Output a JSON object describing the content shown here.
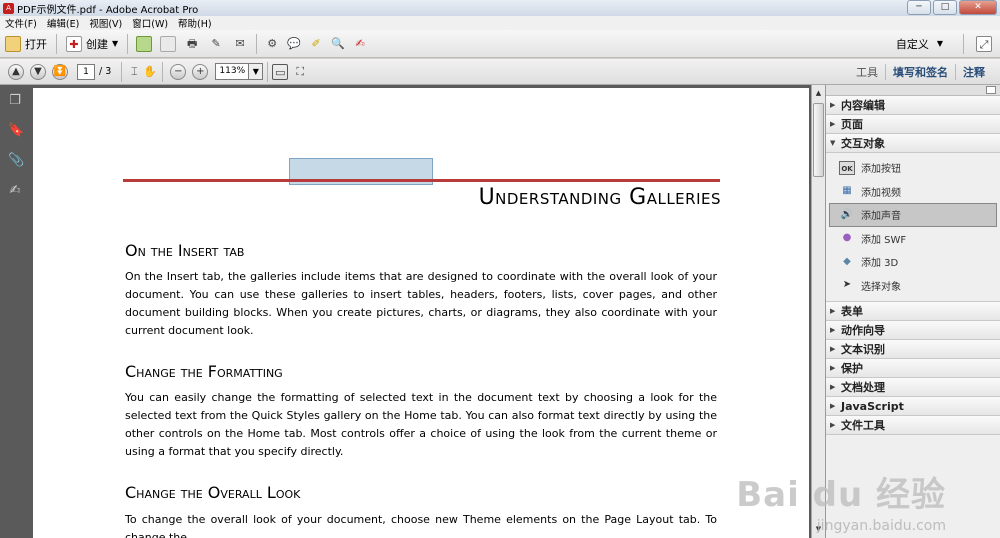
{
  "window": {
    "title": "PDF示例文件.pdf - Adobe Acrobat Pro",
    "min": "─",
    "max": "□",
    "close": "✕"
  },
  "menu": [
    "文件(F)",
    "编辑(E)",
    "视图(V)",
    "窗口(W)",
    "帮助(H)"
  ],
  "toolbar": {
    "open_label": "打开",
    "create_label": "创建",
    "customize_label": "自定义"
  },
  "nav": {
    "page_current": "1",
    "page_total": "/ 3",
    "zoom": "113%"
  },
  "task_links": [
    "工具",
    "填写和签名",
    "注释"
  ],
  "document": {
    "title": "Understanding Galleries",
    "sections": [
      {
        "heading": "On the Insert tab",
        "body": "On the Insert tab, the galleries include items that are designed to coordinate with the overall look of your document. You can use these galleries to insert tables, headers, footers, lists, cover pages, and other document building blocks. When you create pictures, charts, or diagrams, they also coordinate with your current document look."
      },
      {
        "heading": "Change the Formatting",
        "body": "You can easily change the formatting of selected text in the document text by choosing a look for the selected text from the Quick Styles gallery on the Home tab. You can also format text directly by using the other controls on the Home tab. Most controls offer a choice of using the look from the current theme or using a format that you specify directly."
      },
      {
        "heading": "Change the Overall Look",
        "body": "To change the overall look of your document, choose new Theme elements on the Page Layout tab. To change the"
      }
    ]
  },
  "panel": {
    "sections_top": [
      {
        "label": "内容编辑",
        "expanded": false
      },
      {
        "label": "页面",
        "expanded": false
      },
      {
        "label": "交互对象",
        "expanded": true
      }
    ],
    "items": [
      {
        "label": "添加按钮",
        "icon": "button-icon",
        "glyph": "OK",
        "selected": false
      },
      {
        "label": "添加视频",
        "icon": "video-icon",
        "glyph": "▦",
        "selected": false
      },
      {
        "label": "添加声音",
        "icon": "sound-icon",
        "glyph": "🔊",
        "selected": true
      },
      {
        "label": "添加 SWF",
        "icon": "swf-icon",
        "glyph": "●",
        "selected": false
      },
      {
        "label": "添加 3D",
        "icon": "3d-icon",
        "glyph": "◆",
        "selected": false
      },
      {
        "label": "选择对象",
        "icon": "select-object-icon",
        "glyph": "➤",
        "selected": false
      }
    ],
    "sections_bottom": [
      {
        "label": "表单"
      },
      {
        "label": "动作向导"
      },
      {
        "label": "文本识别"
      },
      {
        "label": "保护"
      },
      {
        "label": "文档处理"
      },
      {
        "label": "JavaScript"
      },
      {
        "label": "文件工具"
      }
    ]
  },
  "watermark": {
    "main": "Bai du 经验",
    "sub": "jingyan.baidu.com"
  },
  "colors": {
    "accent_rule": "#b83b3b",
    "doc_bg": "#5a5a5a"
  }
}
